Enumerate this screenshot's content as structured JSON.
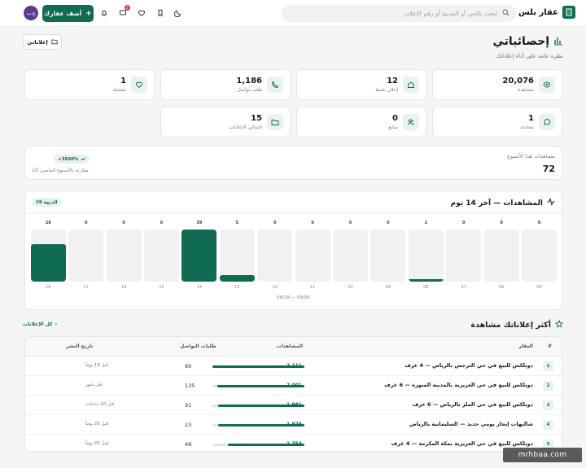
{
  "header": {
    "brand": "عقار بلس",
    "search_placeholder": "ابحث بالحي أو المدينة أو رقم الإعلان",
    "add_button": "أضف عقارك",
    "avatar_initials": "ع.ب",
    "notif_count": "2"
  },
  "page": {
    "title": "إحصائياتي",
    "subtitle": "نظرة عامة على أداء إعلاناتك",
    "my_ads_button": "إعلاناتي"
  },
  "stats": [
    {
      "value": "20,076",
      "label": "مشاهدة",
      "icon": "eye-icon"
    },
    {
      "value": "12",
      "label": "إعلان نشط",
      "icon": "home-icon"
    },
    {
      "value": "1,186",
      "label": "طلب تواصل",
      "icon": "phone-icon"
    },
    {
      "value": "1",
      "label": "مفضلة",
      "icon": "heart-icon"
    },
    {
      "value": "1",
      "label": "محادثة",
      "icon": "chat-icon"
    },
    {
      "value": "0",
      "label": "متابع",
      "icon": "users-icon"
    },
    {
      "value": "15",
      "label": "إجمالي الإعلانات",
      "icon": "folder-icon"
    }
  ],
  "week": {
    "title": "مشاهدات هذا الأسبوع",
    "value": "72",
    "change": "+3500%",
    "compare": "مقارنة بالأسبوع الماضي (2)"
  },
  "views_chart": {
    "title": "المشاهدات — آخر 14 يوم",
    "peak": "الذروة 39",
    "range": "09/05 — 09/18"
  },
  "chart_data": {
    "type": "bar",
    "categories": [
      "05",
      "06",
      "07",
      "08",
      "09",
      "10",
      "11",
      "12",
      "13",
      "14",
      "15",
      "16",
      "17",
      "18"
    ],
    "values": [
      0,
      0,
      0,
      2,
      0,
      0,
      0,
      0,
      5,
      39,
      0,
      0,
      0,
      28
    ],
    "title": "المشاهدات — آخر 14 يوم",
    "ylim": [
      0,
      39
    ]
  },
  "top_ads": {
    "title": "أكثر إعلاناتك مشاهدة",
    "all_link": "كل الإعلانات",
    "columns": {
      "rank": "#",
      "property": "العقار",
      "views": "المشاهدات",
      "contacts": "طلبات التواصل",
      "posted": "تاريخ النشر"
    },
    "rows": [
      {
        "rank": "1",
        "name": "دوبلكس للبيع في حي النرجس بالرياض — 4 غرف",
        "views": "2,111",
        "views_num": 2111,
        "contacts": "89",
        "posted": "قبل 18 يوماً"
      },
      {
        "rank": "2",
        "name": "دوبلكس للبيع في حي العزيزية بالمدينة المنورة — 6 غرف",
        "views": "2,001",
        "views_num": 2001,
        "contacts": "135",
        "posted": "قبل شهر"
      },
      {
        "rank": "3",
        "name": "دوبلكس للبيع في حي الملز بالرياض — 6 غرف",
        "views": "1,981",
        "views_num": 1981,
        "contacts": "91",
        "posted": "قبل 10 ساعات"
      },
      {
        "rank": "4",
        "name": "شاليهات إيجار يومي جديد — السليمانية بالرياض",
        "views": "1,976",
        "views_num": 1976,
        "contacts": "23",
        "posted": "قبل 20 يوماً"
      },
      {
        "rank": "5",
        "name": "دوبلكس للبيع في حي العزيزية بمكة المكرمة — 4 غرف",
        "views": "1,754",
        "views_num": 1754,
        "contacts": "48",
        "posted": "قبل 20 يوماً"
      }
    ]
  },
  "watermark": "mrhbaa.com"
}
